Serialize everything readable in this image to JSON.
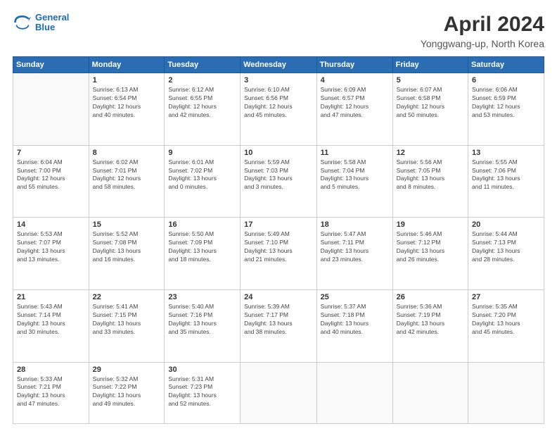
{
  "logo": {
    "line1": "General",
    "line2": "Blue"
  },
  "title": "April 2024",
  "subtitle": "Yonggwang-up, North Korea",
  "headers": [
    "Sunday",
    "Monday",
    "Tuesday",
    "Wednesday",
    "Thursday",
    "Friday",
    "Saturday"
  ],
  "weeks": [
    [
      {
        "day": "",
        "info": ""
      },
      {
        "day": "1",
        "info": "Sunrise: 6:13 AM\nSunset: 6:54 PM\nDaylight: 12 hours\nand 40 minutes."
      },
      {
        "day": "2",
        "info": "Sunrise: 6:12 AM\nSunset: 6:55 PM\nDaylight: 12 hours\nand 42 minutes."
      },
      {
        "day": "3",
        "info": "Sunrise: 6:10 AM\nSunset: 6:56 PM\nDaylight: 12 hours\nand 45 minutes."
      },
      {
        "day": "4",
        "info": "Sunrise: 6:09 AM\nSunset: 6:57 PM\nDaylight: 12 hours\nand 47 minutes."
      },
      {
        "day": "5",
        "info": "Sunrise: 6:07 AM\nSunset: 6:58 PM\nDaylight: 12 hours\nand 50 minutes."
      },
      {
        "day": "6",
        "info": "Sunrise: 6:06 AM\nSunset: 6:59 PM\nDaylight: 12 hours\nand 53 minutes."
      }
    ],
    [
      {
        "day": "7",
        "info": "Sunrise: 6:04 AM\nSunset: 7:00 PM\nDaylight: 12 hours\nand 55 minutes."
      },
      {
        "day": "8",
        "info": "Sunrise: 6:02 AM\nSunset: 7:01 PM\nDaylight: 12 hours\nand 58 minutes."
      },
      {
        "day": "9",
        "info": "Sunrise: 6:01 AM\nSunset: 7:02 PM\nDaylight: 13 hours\nand 0 minutes."
      },
      {
        "day": "10",
        "info": "Sunrise: 5:59 AM\nSunset: 7:03 PM\nDaylight: 13 hours\nand 3 minutes."
      },
      {
        "day": "11",
        "info": "Sunrise: 5:58 AM\nSunset: 7:04 PM\nDaylight: 13 hours\nand 5 minutes."
      },
      {
        "day": "12",
        "info": "Sunrise: 5:56 AM\nSunset: 7:05 PM\nDaylight: 13 hours\nand 8 minutes."
      },
      {
        "day": "13",
        "info": "Sunrise: 5:55 AM\nSunset: 7:06 PM\nDaylight: 13 hours\nand 11 minutes."
      }
    ],
    [
      {
        "day": "14",
        "info": "Sunrise: 5:53 AM\nSunset: 7:07 PM\nDaylight: 13 hours\nand 13 minutes."
      },
      {
        "day": "15",
        "info": "Sunrise: 5:52 AM\nSunset: 7:08 PM\nDaylight: 13 hours\nand 16 minutes."
      },
      {
        "day": "16",
        "info": "Sunrise: 5:50 AM\nSunset: 7:09 PM\nDaylight: 13 hours\nand 18 minutes."
      },
      {
        "day": "17",
        "info": "Sunrise: 5:49 AM\nSunset: 7:10 PM\nDaylight: 13 hours\nand 21 minutes."
      },
      {
        "day": "18",
        "info": "Sunrise: 5:47 AM\nSunset: 7:11 PM\nDaylight: 13 hours\nand 23 minutes."
      },
      {
        "day": "19",
        "info": "Sunrise: 5:46 AM\nSunset: 7:12 PM\nDaylight: 13 hours\nand 26 minutes."
      },
      {
        "day": "20",
        "info": "Sunrise: 5:44 AM\nSunset: 7:13 PM\nDaylight: 13 hours\nand 28 minutes."
      }
    ],
    [
      {
        "day": "21",
        "info": "Sunrise: 5:43 AM\nSunset: 7:14 PM\nDaylight: 13 hours\nand 30 minutes."
      },
      {
        "day": "22",
        "info": "Sunrise: 5:41 AM\nSunset: 7:15 PM\nDaylight: 13 hours\nand 33 minutes."
      },
      {
        "day": "23",
        "info": "Sunrise: 5:40 AM\nSunset: 7:16 PM\nDaylight: 13 hours\nand 35 minutes."
      },
      {
        "day": "24",
        "info": "Sunrise: 5:39 AM\nSunset: 7:17 PM\nDaylight: 13 hours\nand 38 minutes."
      },
      {
        "day": "25",
        "info": "Sunrise: 5:37 AM\nSunset: 7:18 PM\nDaylight: 13 hours\nand 40 minutes."
      },
      {
        "day": "26",
        "info": "Sunrise: 5:36 AM\nSunset: 7:19 PM\nDaylight: 13 hours\nand 42 minutes."
      },
      {
        "day": "27",
        "info": "Sunrise: 5:35 AM\nSunset: 7:20 PM\nDaylight: 13 hours\nand 45 minutes."
      }
    ],
    [
      {
        "day": "28",
        "info": "Sunrise: 5:33 AM\nSunset: 7:21 PM\nDaylight: 13 hours\nand 47 minutes."
      },
      {
        "day": "29",
        "info": "Sunrise: 5:32 AM\nSunset: 7:22 PM\nDaylight: 13 hours\nand 49 minutes."
      },
      {
        "day": "30",
        "info": "Sunrise: 5:31 AM\nSunset: 7:23 PM\nDaylight: 13 hours\nand 52 minutes."
      },
      {
        "day": "",
        "info": ""
      },
      {
        "day": "",
        "info": ""
      },
      {
        "day": "",
        "info": ""
      },
      {
        "day": "",
        "info": ""
      }
    ]
  ]
}
